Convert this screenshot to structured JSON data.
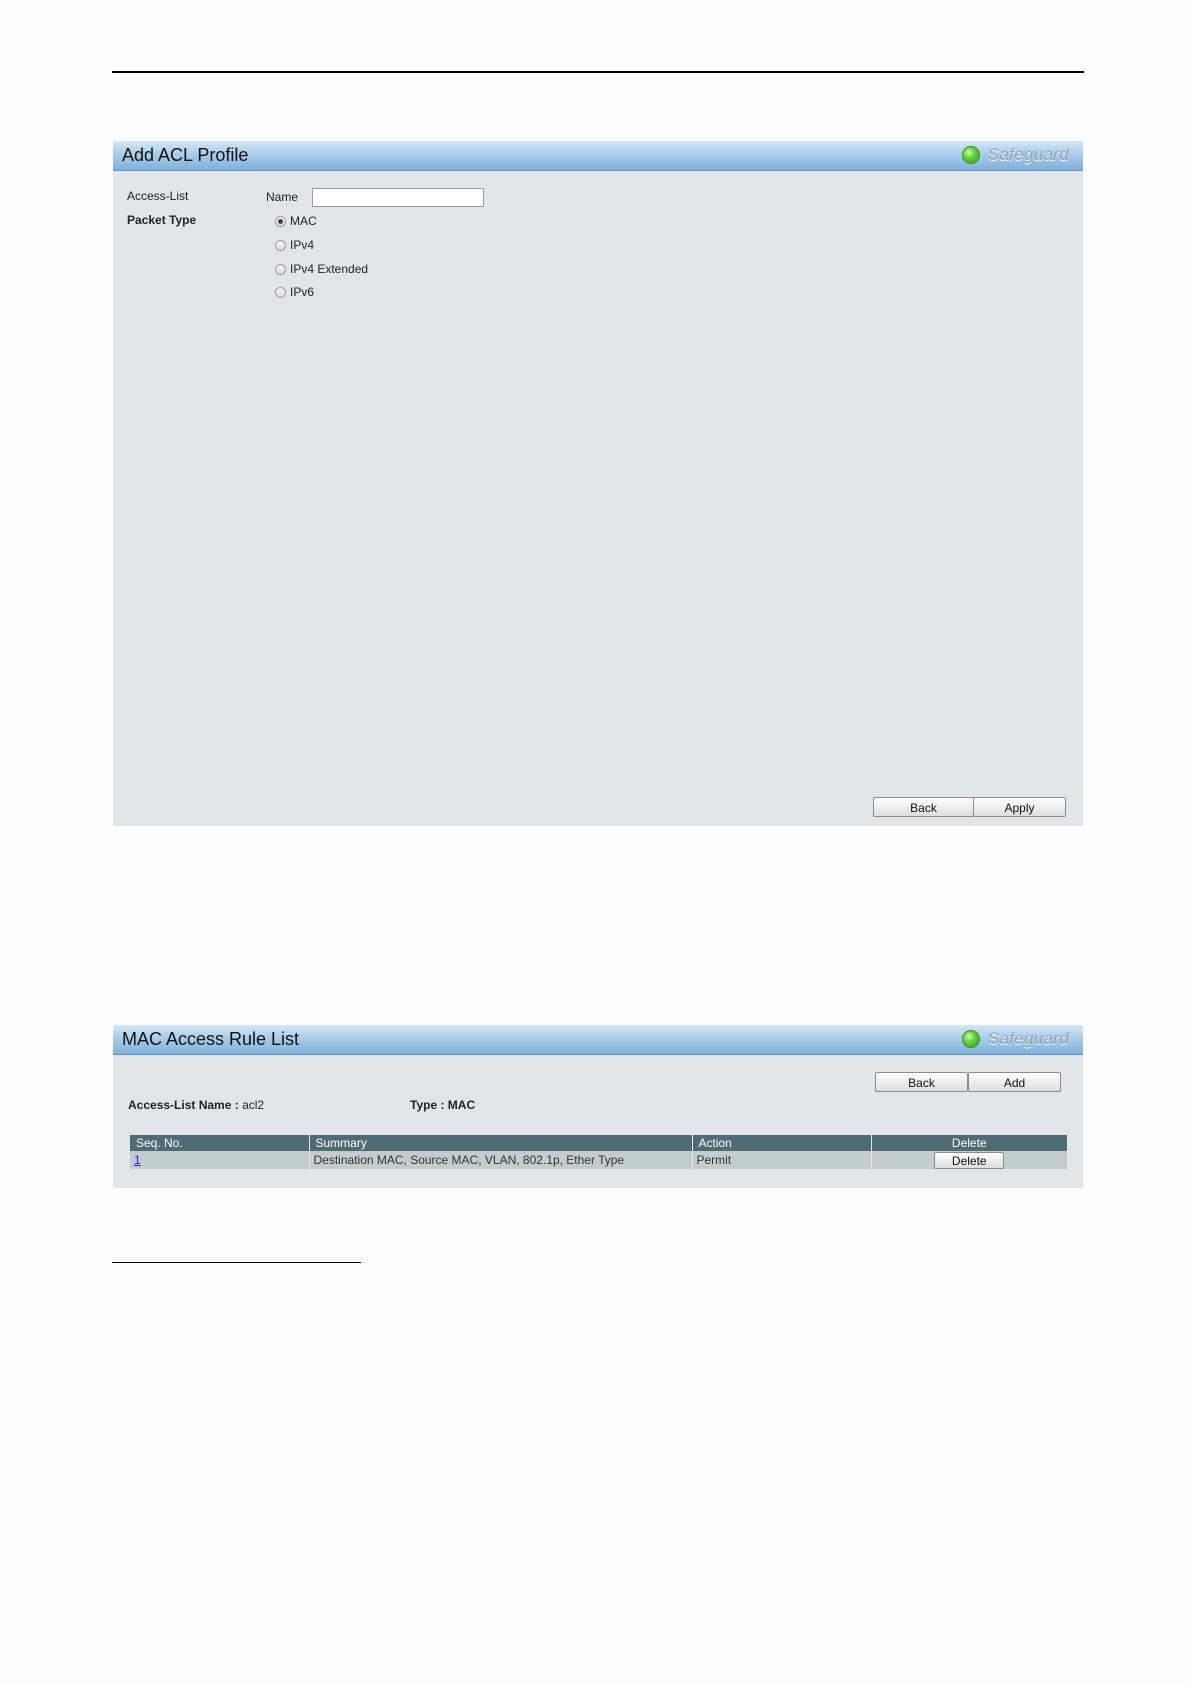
{
  "add_acl_profile": {
    "title": "Add ACL Profile",
    "safeguard": "Safeguard",
    "access_list_label": "Access-List",
    "name_label": "Name",
    "name_value": "",
    "packet_type_label": "Packet Type",
    "packet_types": [
      "MAC",
      "IPv4",
      "IPv4 Extended",
      "IPv6"
    ],
    "selected_packet_type": "MAC",
    "back_label": "Back",
    "apply_label": "Apply"
  },
  "mac_access_rule_list": {
    "title": "MAC Access Rule List",
    "safeguard": "Safeguard",
    "back_label": "Back",
    "add_label": "Add",
    "access_list_name_label": "Access-List Name :",
    "access_list_name_value": "acl2",
    "type_label": "Type : MAC",
    "columns": [
      "Seq. No.",
      "Summary",
      "Action",
      "Delete"
    ],
    "rows": [
      {
        "seq": "1",
        "summary": "Destination MAC, Source MAC, VLAN, 802.1p, Ether Type",
        "action": "Permit",
        "delete_label": "Delete"
      }
    ]
  },
  "colors": {
    "header_blue": "#a9cde9",
    "panel_bg": "#e3e6e9",
    "table_header": "#4f6b73",
    "safeguard_green": "#5fd23a"
  },
  "icons": [
    "safeguard-status-icon"
  ]
}
